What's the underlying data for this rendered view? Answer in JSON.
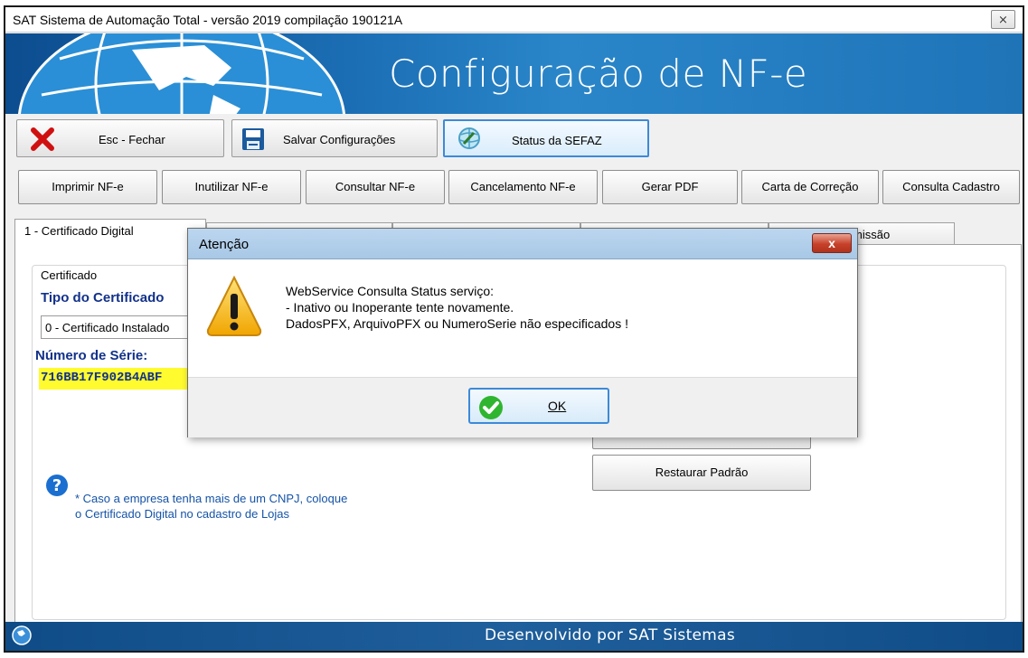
{
  "window": {
    "title": "SAT Sistema de Automação Total - versão 2019 compilação 190121A",
    "close_label": "⨯"
  },
  "banner": {
    "heading": "Configuração de NF-e"
  },
  "toolbar": {
    "close_label": "Esc - Fechar",
    "save_label": "Salvar Configurações",
    "status_label": "Status da SEFAZ"
  },
  "actions": [
    "Imprimir NF-e",
    "Inutilizar NF-e",
    "Consultar NF-e",
    "Cancelamento NF-e",
    "Gerar PDF",
    "Carta de Correção",
    "Consulta Cadastro"
  ],
  "tabs": [
    {
      "label": "1 - Certificado Digital"
    },
    {
      "label": ""
    },
    {
      "label": ""
    },
    {
      "label": ""
    },
    {
      "label": "missão"
    }
  ],
  "certificate": {
    "group_label": "Certificado",
    "type_label": "Tipo do Certificado",
    "type_value": "0 - Certificado Instalado",
    "serial_label": "Número de Série:",
    "serial_value": "716BB17F902B4ABF",
    "help_line1": "* Caso a empresa tenha mais de um CNPJ, coloque",
    "help_line2": "o Certificado Digital no cadastro de Lojas",
    "restore_label": "Restaurar Padrão"
  },
  "footer": {
    "text": "Desenvolvido por SAT Sistemas"
  },
  "dialog": {
    "title": "Atenção",
    "close_label": "x",
    "message": [
      "WebService Consulta Status serviço:",
      "- Inativo ou Inoperante tente novamente.",
      "DadosPFX, ArquivoPFX ou NumeroSerie não especificados !"
    ],
    "ok_label": "OK"
  },
  "colors": {
    "banner": "#1c6fb5",
    "footer": "#0f4c87",
    "label_blue": "#12318a",
    "serial_highlight": "#fffb2e",
    "help_text": "#1553a7"
  },
  "icons": {
    "close": "red-x-icon",
    "save": "floppy-disk-icon",
    "status": "globe-status-icon",
    "help": "question-icon",
    "warning": "warning-icon",
    "ok": "green-check-icon"
  }
}
